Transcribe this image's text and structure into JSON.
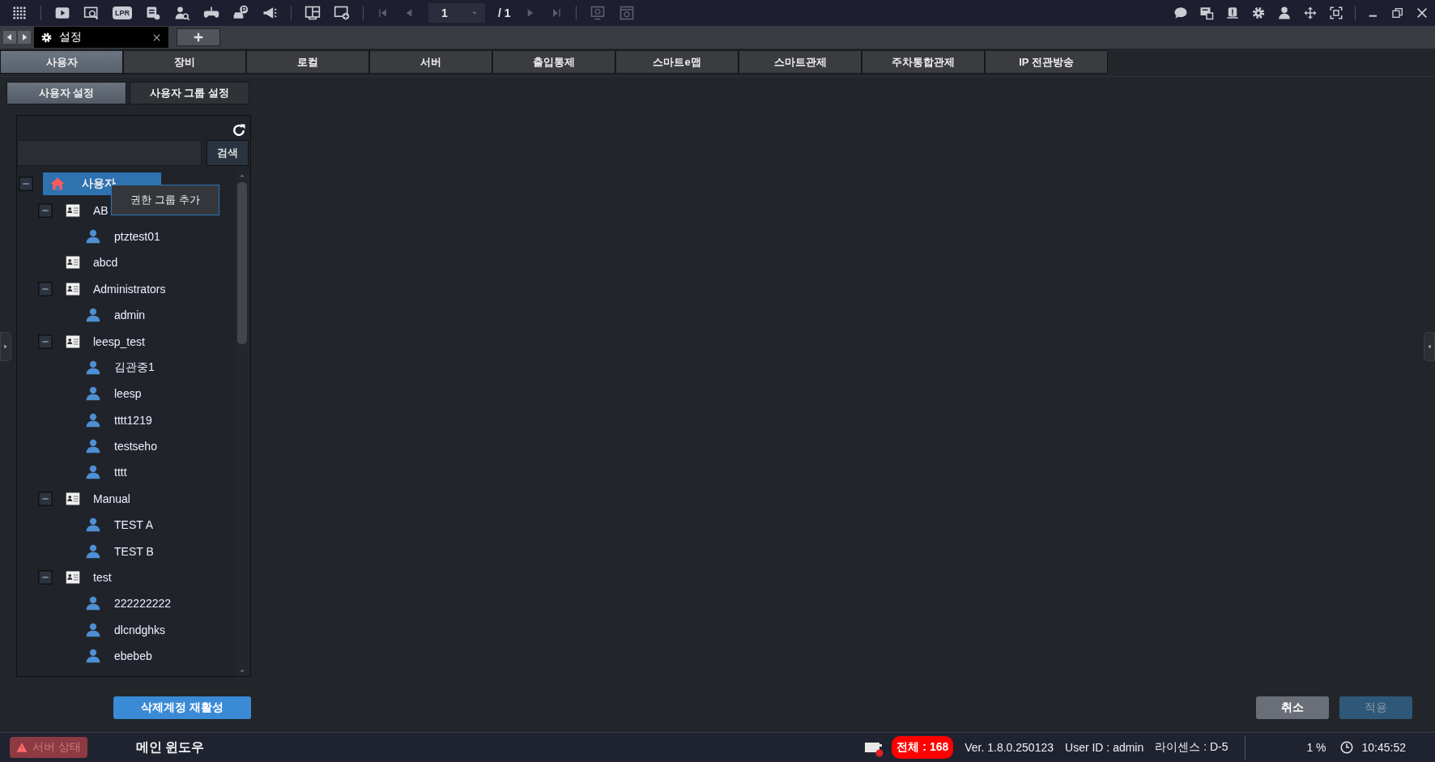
{
  "toolbar": {
    "lpr_label": "LPR",
    "page": "1",
    "page_total": "/ 1"
  },
  "doc_tabs": [
    {
      "label": "설정",
      "selected": true
    }
  ],
  "main_tabs": [
    {
      "label": "사용자",
      "selected": true
    },
    {
      "label": "장비",
      "selected": false
    },
    {
      "label": "로컬",
      "selected": false
    },
    {
      "label": "서버",
      "selected": false
    },
    {
      "label": "출입통제",
      "selected": false
    },
    {
      "label": "스마트e맵",
      "selected": false
    },
    {
      "label": "스마트관제",
      "selected": false
    },
    {
      "label": "주차통합관제",
      "selected": false
    },
    {
      "label": "IP 전관방송",
      "selected": false
    }
  ],
  "sub_tabs": [
    {
      "label": "사용자 설정",
      "selected": true
    },
    {
      "label": "사용자 그룹 설정",
      "selected": false
    }
  ],
  "search": {
    "button": "검색"
  },
  "tree": [
    {
      "kind": "root",
      "label": "사용자",
      "expanded": true,
      "selected": true,
      "children": [
        {
          "kind": "group",
          "label": "AB",
          "expanded": true,
          "children": [
            {
              "kind": "user",
              "label": "ptztest01"
            }
          ]
        },
        {
          "kind": "group",
          "label": "abcd"
        },
        {
          "kind": "group",
          "label": "Administrators",
          "expanded": true,
          "children": [
            {
              "kind": "user",
              "label": "admin"
            }
          ]
        },
        {
          "kind": "group",
          "label": "leesp_test",
          "expanded": true,
          "children": [
            {
              "kind": "user",
              "label": "김관중1"
            },
            {
              "kind": "user",
              "label": "leesp"
            },
            {
              "kind": "user",
              "label": "tttt1219"
            },
            {
              "kind": "user",
              "label": "testseho"
            },
            {
              "kind": "user",
              "label": "tttt"
            }
          ]
        },
        {
          "kind": "group",
          "label": "Manual",
          "expanded": true,
          "children": [
            {
              "kind": "user",
              "label": "TEST A"
            },
            {
              "kind": "user",
              "label": "TEST B"
            }
          ]
        },
        {
          "kind": "group",
          "label": "test",
          "expanded": true,
          "children": [
            {
              "kind": "user",
              "label": "222222222"
            },
            {
              "kind": "user",
              "label": "dlcndghks"
            },
            {
              "kind": "user",
              "label": "ebebeb"
            }
          ]
        }
      ]
    }
  ],
  "context_menu": {
    "items": [
      "권한 그룹 추가"
    ]
  },
  "restore_button": "삭제계정 재활성",
  "buttons": [
    {
      "label": "취소",
      "disabled": false
    },
    {
      "label": "적용",
      "disabled": true
    }
  ],
  "status_bar": {
    "server_status": {
      "label": "서버 상태",
      "disabled": true
    },
    "window_name": "메인 윈도우",
    "total": "전체 : 168",
    "version": "Ver. 1.8.0.250123",
    "user_id": "User ID : admin",
    "license": "라이센스 : D-5",
    "cpu": "1 %",
    "time": "10:45:52"
  }
}
